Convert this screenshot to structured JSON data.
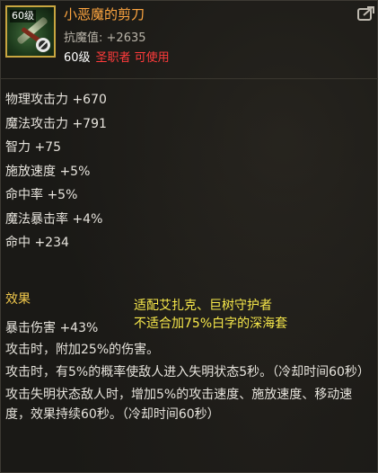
{
  "header": {
    "level_badge": "60级",
    "item_name": "小恶魔的剪刀",
    "resist_label": "抗魔值:",
    "resist_value": "+2635",
    "required_level": "60级",
    "required_class": "圣职者",
    "usable_text": "可使用",
    "icons": {
      "item": "scissors-icon",
      "restriction": "no-entry-icon",
      "share": "share-icon"
    },
    "colors": {
      "item_name": "#ffa640",
      "class_restriction": "#ff3b3b",
      "icon_border": "#c8a640"
    }
  },
  "stats": [
    "物理攻击力 +670",
    "魔法攻击力 +791",
    "智力 +75",
    "施放速度 +5%",
    "命中率 +5%",
    "魔法暴击率 +4%",
    "命中 +234"
  ],
  "effect": {
    "title": "效果",
    "annotation_lines": [
      "适配艾扎克、巨树守护者",
      "不适合加75%白字的深海套"
    ],
    "crit_line": "暴击伤害 +43%",
    "lines": [
      "攻击时，附加25%的伤害。",
      "攻击时，有5%的概率使敌人进入失明状态5秒。（冷却时间60秒）",
      "攻击失明状态敌人时，增加5%的攻击速度、施放速度、移动速度，效果持续60秒。（冷却时间60秒）"
    ],
    "colors": {
      "title": "#f2c94c",
      "annotation": "#f7e84a"
    }
  }
}
